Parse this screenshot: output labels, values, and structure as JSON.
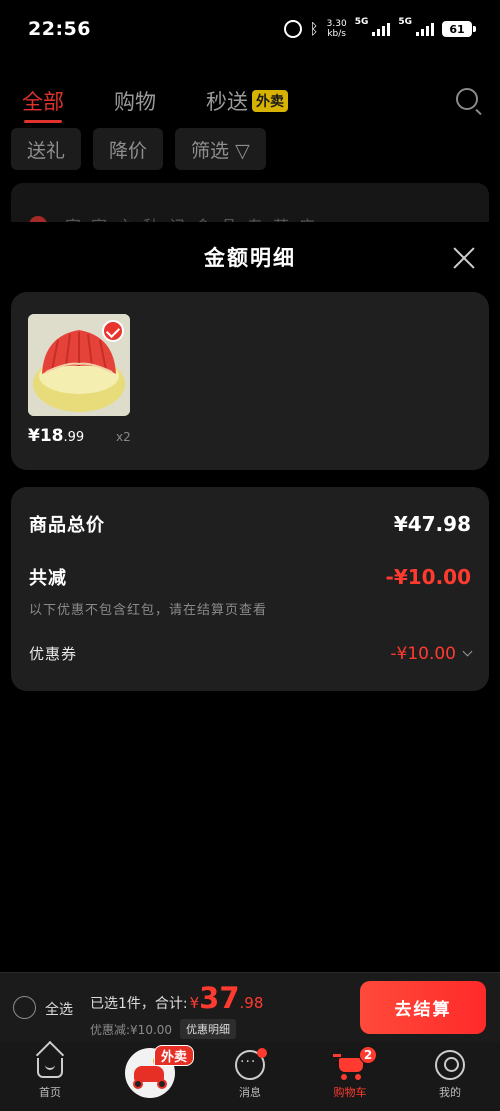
{
  "status_bar": {
    "time": "22:56",
    "net_speed_value": "3.30",
    "net_speed_unit": "kb/s",
    "net1": "5G",
    "net2": "5G",
    "battery": "61"
  },
  "background": {
    "tabs": [
      {
        "label": "全部",
        "active": true
      },
      {
        "label": "购物",
        "active": false
      },
      {
        "label": "秒送",
        "active": false,
        "badge": "外卖"
      }
    ],
    "chips": [
      "送礼",
      "降价",
      "筛选 ▽"
    ],
    "card_text": "家家之秋记食品专营店"
  },
  "sheet": {
    "title": "金额明细",
    "product": {
      "price_int": "¥18",
      "price_dec": ".99",
      "qty": "x2"
    },
    "summary": {
      "total_label": "商品总价",
      "total_value": "¥47.98",
      "reduce_label": "共减",
      "reduce_value": "-¥10.00",
      "note": "以下优惠不包含红包，请在结算页查看",
      "coupon_label": "优惠券",
      "coupon_value": "-¥10.00"
    }
  },
  "checkout": {
    "select_all": "全选",
    "selected_text": "已选1件，合计:",
    "yen": "¥",
    "total_int": "37",
    "total_dec": ".98",
    "discount_text": "优惠减:¥10.00",
    "detail_btn": "优惠明细",
    "checkout_btn": "去结算"
  },
  "nav": {
    "items": [
      {
        "label": "首页",
        "icon": "home-icon"
      },
      {
        "label": "",
        "icon": "delivery-scooter-icon",
        "badge": "外卖"
      },
      {
        "label": "消息",
        "icon": "message-icon"
      },
      {
        "label": "购物车",
        "icon": "cart-icon",
        "badge": "2"
      },
      {
        "label": "我的",
        "icon": "profile-icon"
      }
    ]
  },
  "colors": {
    "accent_red": "#ff3b30",
    "card_bg": "#1f1f1f",
    "badge_yellow": "#d8b200"
  }
}
